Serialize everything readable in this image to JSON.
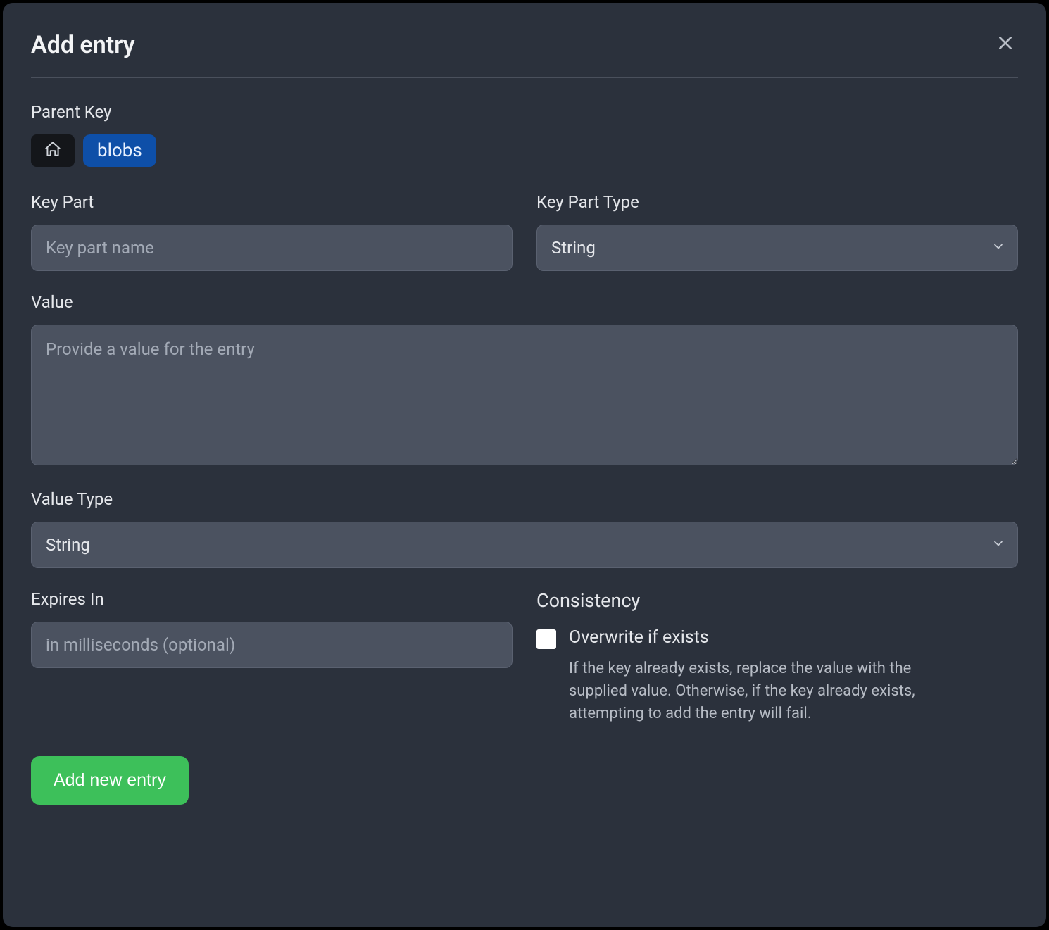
{
  "header": {
    "title": "Add entry"
  },
  "parentKey": {
    "label": "Parent Key",
    "chip": "blobs"
  },
  "keyPart": {
    "label": "Key Part",
    "placeholder": "Key part name",
    "value": ""
  },
  "keyPartType": {
    "label": "Key Part Type",
    "selected": "String"
  },
  "value": {
    "label": "Value",
    "placeholder": "Provide a value for the entry",
    "value": ""
  },
  "valueType": {
    "label": "Value Type",
    "selected": "String"
  },
  "expiresIn": {
    "label": "Expires In",
    "placeholder": "in milliseconds (optional)",
    "value": ""
  },
  "consistency": {
    "title": "Consistency",
    "overwrite": {
      "label": "Overwrite if exists",
      "description": "If the key already exists, replace the value with the supplied value. Otherwise, if the key already exists, attempting to add the entry will fail.",
      "checked": false
    }
  },
  "submit": {
    "label": "Add new entry"
  }
}
